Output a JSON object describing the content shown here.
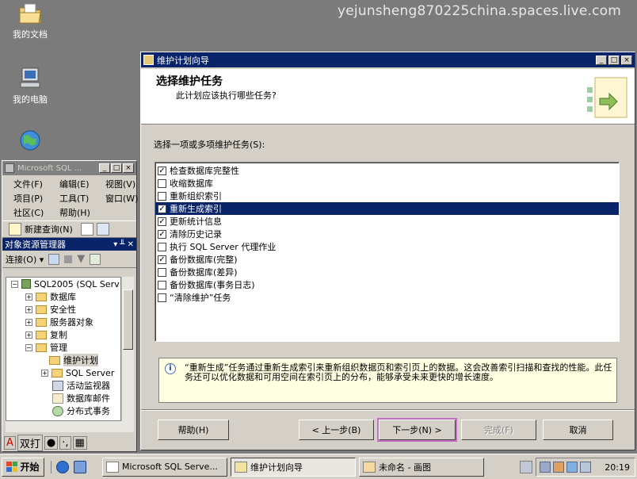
{
  "desktop": {
    "watermark": "yejunsheng870225china.spaces.live.com",
    "icons": [
      {
        "label": "我的文档",
        "icon": "my-documents-icon"
      },
      {
        "label": "我的电脑",
        "icon": "my-computer-icon"
      },
      {
        "label": "",
        "icon": "network-globe-icon"
      }
    ]
  },
  "ssms": {
    "title": "Microsoft SQL ...",
    "menu": [
      "文件(F)",
      "编辑(E)",
      "视图(V)",
      "项目(P)",
      "工具(T)",
      "窗口(W)",
      "社区(C)",
      "帮助(H)"
    ],
    "toolbar": {
      "new_query": "新建查询(N)"
    },
    "object_explorer": {
      "title": "对象资源管理器",
      "pin": "▾ ╨ ✕",
      "connect": "连接(O) ▾",
      "tree": [
        {
          "label": "SQL2005 (SQL Serv",
          "expander": "−",
          "indent": 0
        },
        {
          "label": "数据库",
          "expander": "+",
          "indent": 1
        },
        {
          "label": "安全性",
          "expander": "+",
          "indent": 1
        },
        {
          "label": "服务器对象",
          "expander": "+",
          "indent": 1
        },
        {
          "label": "复制",
          "expander": "+",
          "indent": 1
        },
        {
          "label": "管理",
          "expander": "−",
          "indent": 1
        },
        {
          "label": "维护计划",
          "expander": "",
          "indent": 2
        },
        {
          "label": "SQL Server",
          "expander": "+",
          "indent": 2
        },
        {
          "label": "活动监视器",
          "expander": "",
          "indent": 2
        },
        {
          "label": "数据库邮件",
          "expander": "",
          "indent": 2
        },
        {
          "label": "分布式事务",
          "expander": "",
          "indent": 2
        }
      ]
    },
    "ime": [
      "A",
      "双打",
      "●",
      "·,",
      "▦"
    ]
  },
  "wizard": {
    "title": "维护计划向导",
    "header_title": "选择维护任务",
    "header_subtitle": "此计划应该执行哪些任务?",
    "prompt": "选择一项或多项维护任务(S):",
    "tasks": [
      {
        "label": "检查数据库完整性",
        "checked": true
      },
      {
        "label": "收缩数据库",
        "checked": false
      },
      {
        "label": "重新组织索引",
        "checked": false
      },
      {
        "label": "重新生成索引",
        "checked": true,
        "selected": true
      },
      {
        "label": "更新统计信息",
        "checked": true
      },
      {
        "label": "清除历史记录",
        "checked": true
      },
      {
        "label": "执行 SQL Server 代理作业",
        "checked": false
      },
      {
        "label": "备份数据库(完整)",
        "checked": true
      },
      {
        "label": "备份数据库(差异)",
        "checked": false
      },
      {
        "label": "备份数据库(事务日志)",
        "checked": false
      },
      {
        "label": "“清除维护”任务",
        "checked": false
      }
    ],
    "description": "“重新生成”任务通过重新生成索引来重新组织数据页和索引页上的数据。这会改善索引扫描和查找的性能。此任务还可以优化数据和可用空间在索引页上的分布，能够承受未来更快的增长速度。",
    "buttons": {
      "help": "帮助(H)",
      "back": "< 上一步(B)",
      "next": "下一步(N) >",
      "finish": "完成(F)",
      "cancel": "取消"
    }
  },
  "taskbar": {
    "start": "开始",
    "tasks": [
      {
        "label": "Microsoft SQL Serve...",
        "active": false
      },
      {
        "label": "维护计划向导",
        "active": true
      },
      {
        "label": "未命名 - 画图",
        "active": false
      }
    ],
    "clock": "20:19"
  },
  "colors": {
    "title_active": "#0a246a",
    "title_inactive": "#808080",
    "face": "#d4d0c8",
    "selection": "#0a246a"
  }
}
